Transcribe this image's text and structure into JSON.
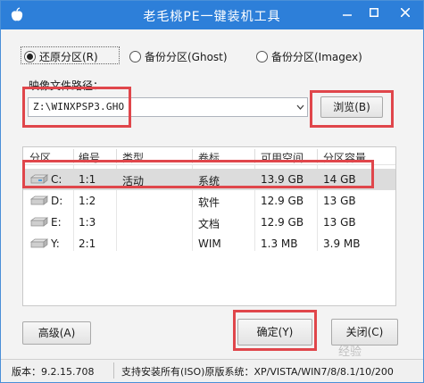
{
  "window": {
    "title": "老毛桃PE一键装机工具",
    "colors": {
      "titlebar": "#2d7fd9",
      "highlight": "#e0464b"
    }
  },
  "icons": {
    "app": "apple-icon",
    "minimize": "minimize-icon",
    "maximize": "maximize-icon",
    "close": "close-icon",
    "combo": "chevron-down-icon",
    "drive": "hard-drive-icon"
  },
  "mode": {
    "options": [
      {
        "label": "还原分区(R)",
        "selected": true
      },
      {
        "label": "备份分区(Ghost)",
        "selected": false
      },
      {
        "label": "备份分区(Imagex)",
        "selected": false
      }
    ]
  },
  "image_path": {
    "label": "映像文件路径：",
    "value": "Z:\\WINXPSP3.GHO",
    "browse_label": "浏览(B)"
  },
  "partition_table": {
    "columns": [
      "分区",
      "编号",
      "类型",
      "卷标",
      "可用空间",
      "分区容量"
    ],
    "rows": [
      {
        "drive": "C:",
        "number": "1:1",
        "type": "活动",
        "label": "系统",
        "free": "13.9 GB",
        "size": "14 GB",
        "selected": true
      },
      {
        "drive": "D:",
        "number": "1:2",
        "type": "",
        "label": "软件",
        "free": "12.9 GB",
        "size": "13 GB",
        "selected": false
      },
      {
        "drive": "E:",
        "number": "1:3",
        "type": "",
        "label": "文档",
        "free": "12.9 GB",
        "size": "13 GB",
        "selected": false
      },
      {
        "drive": "Y:",
        "number": "2:1",
        "type": "",
        "label": "WIM",
        "free": "1.3 MB",
        "size": "3.9 MB",
        "selected": false
      }
    ]
  },
  "buttons": {
    "advanced": "高级(A)",
    "ok": "确定(Y)",
    "close": "关闭(C)"
  },
  "status": {
    "version": "版本：9.2.15.708",
    "support": "支持安装所有(ISO)原版系统：XP/VISTA/WIN7/8/8.1/10/200"
  },
  "watermark": "经验"
}
